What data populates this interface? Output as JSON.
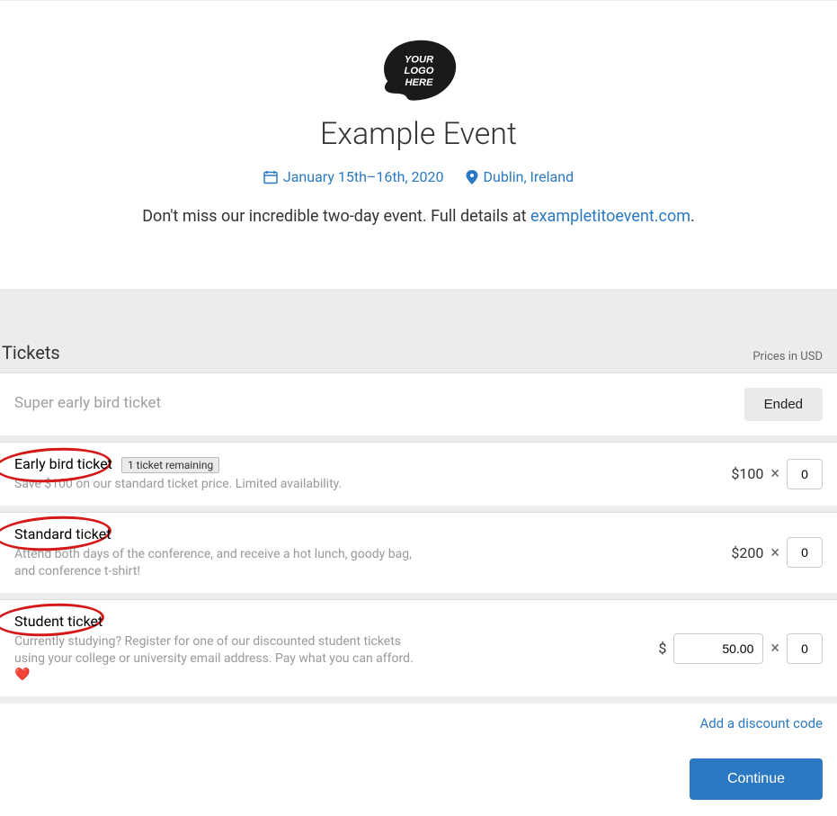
{
  "logo_text": {
    "line1": "YOUR",
    "line2": "LOGO",
    "line3": "HERE"
  },
  "event": {
    "title": "Example Event",
    "date_range": "January 15th–16th, 2020",
    "location": "Dublin, Ireland",
    "description_prefix": "Don't miss our incredible two-day event. Full details at ",
    "description_link": "exampletitoevent.com",
    "description_suffix": "."
  },
  "tickets": {
    "heading": "Tickets",
    "currency_note": "Prices in USD",
    "super": {
      "name": "Super early bird ticket",
      "ended_label": "Ended"
    },
    "early": {
      "name": "Early bird ticket",
      "remaining_badge": "1 ticket remaining",
      "desc": "Save $100 on our standard ticket price. Limited availability.",
      "price": "$100",
      "qty": "0"
    },
    "standard": {
      "name": "Standard ticket",
      "desc": "Attend both days of the conference, and receive a hot lunch, goody bag, and conference t-shirt!",
      "price": "$200",
      "qty": "0"
    },
    "student": {
      "name": "Student ticket",
      "desc": "Currently studying? Register for one of our discounted student tickets using your college or university email address. Pay what you can afford.",
      "currency_symbol": "$",
      "price_value": "50.00",
      "qty": "0"
    },
    "discount_label": "Add a discount code",
    "continue_label": "Continue"
  }
}
